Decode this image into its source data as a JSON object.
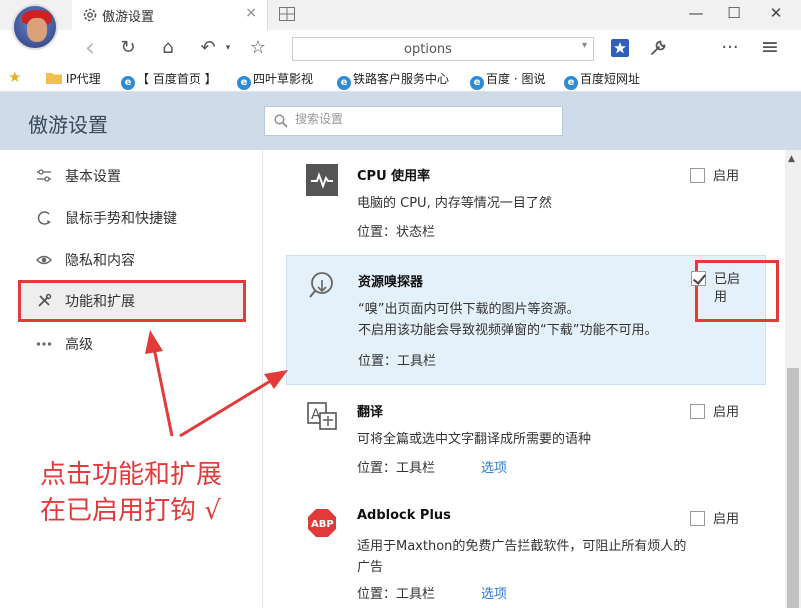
{
  "tab": {
    "title": "傲游设置",
    "close": "×"
  },
  "window": {
    "minimize": "—",
    "maximize": "☐",
    "close": "✕"
  },
  "address": {
    "value": "options"
  },
  "toolbar": {
    "back": "‹",
    "reload": "↻",
    "home": "⌂",
    "undo": "↶",
    "favorite": "☆",
    "more": "···",
    "menu": "≡"
  },
  "bookmarks": [
    {
      "label": "IP代理"
    },
    {
      "label": "【 百度首页 】"
    },
    {
      "label": "四叶草影视"
    },
    {
      "label": "铁路客户服务中心"
    },
    {
      "label": "百度 · 图说"
    },
    {
      "label": "百度短网址"
    }
  ],
  "settings": {
    "title": "傲游设置",
    "search_placeholder": "搜索设置"
  },
  "sidebar": {
    "items": [
      {
        "label": "基本设置"
      },
      {
        "label": "鼠标手势和快捷键"
      },
      {
        "label": "隐私和内容"
      },
      {
        "label": "功能和扩展"
      },
      {
        "label": "高级"
      }
    ]
  },
  "annotation": {
    "line1": "点击功能和扩展",
    "line2": "在已启用打钩 √"
  },
  "features": [
    {
      "name": "CPU 使用率",
      "desc1": "电脑的 CPU, 内存等情况一目了然",
      "desc2": "",
      "location": "位置：状态栏",
      "option": "",
      "toggle": "启用",
      "enabled": false
    },
    {
      "name": "资源嗅探器",
      "desc1": "“嗅”出页面内可供下载的图片等资源。",
      "desc2": "不启用该功能会导致视频弹窗的“下载”功能不可用。",
      "location": "位置：工具栏",
      "option": "",
      "toggle": "已启用",
      "enabled": true
    },
    {
      "name": "翻译",
      "desc1": "可将全篇或选中文字翻译成所需要的语种",
      "desc2": "",
      "location": "位置：工具栏",
      "option": "选项",
      "toggle": "启用",
      "enabled": false
    },
    {
      "name": "Adblock Plus",
      "desc1": "适用于Maxthon的免费广告拦截软件，可阻止所有烦人的广告",
      "desc2": "",
      "location": "位置：工具栏",
      "option": "选项",
      "toggle": "启用",
      "enabled": false
    }
  ],
  "colors": {
    "header_bg": "#cfdbe8",
    "annotation": "#e53a3a",
    "link": "#2a7ad0",
    "highlight_bg": "#e4f0fa"
  }
}
